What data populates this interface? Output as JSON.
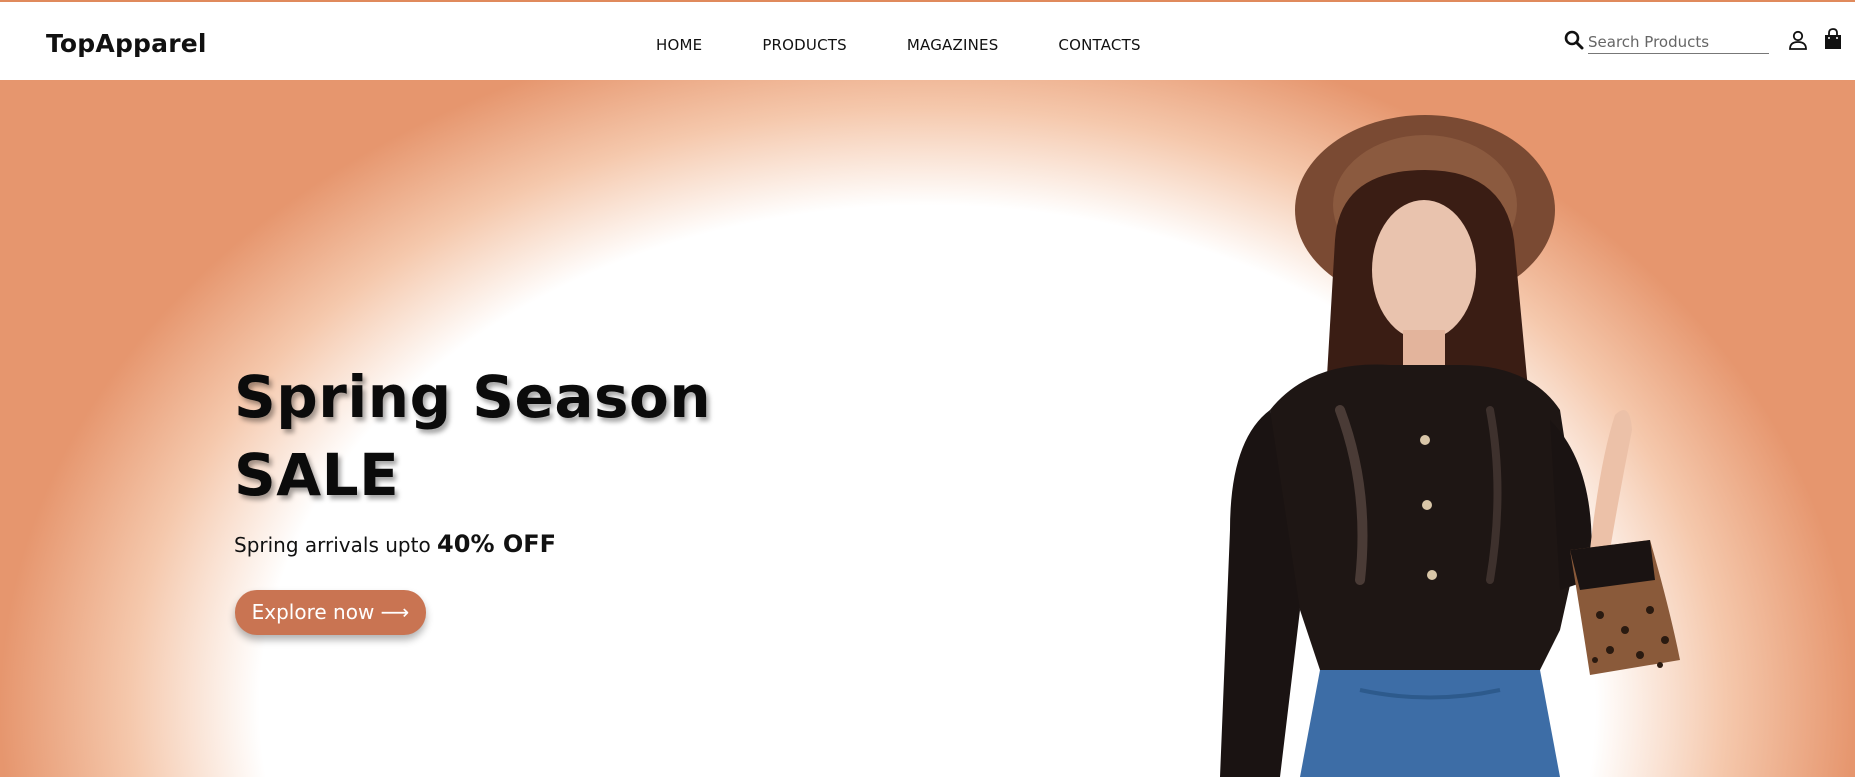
{
  "brand": {
    "name": "TopApparel",
    "accent": "#e08a5c",
    "button_color": "#c97452"
  },
  "nav": {
    "items": [
      "HOME",
      "PRODUCTS",
      "MAGAZINES",
      "CONTACTS"
    ]
  },
  "search": {
    "placeholder": "Search Products",
    "value": ""
  },
  "icons": {
    "search": "search-icon",
    "user": "user-icon",
    "cart": "shopping-bag-icon"
  },
  "hero": {
    "title_line1": "Spring Season",
    "title_line2": "SALE",
    "subtitle_prefix": "Spring arrivals upto",
    "subtitle_highlight": "40% OFF",
    "cta_label": "Explore now ⟶"
  }
}
